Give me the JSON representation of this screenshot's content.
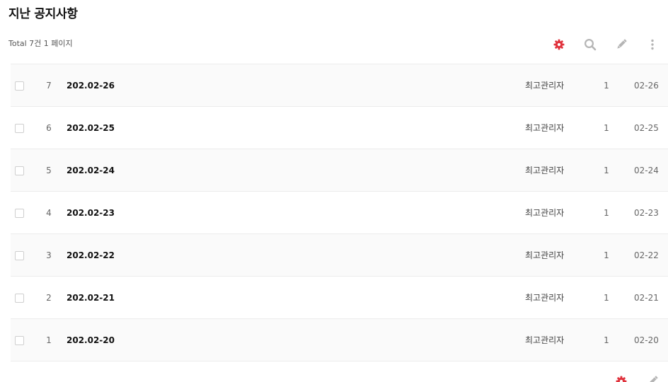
{
  "board": {
    "title": "지난 공지사항",
    "total_text": "Total 7건 1 페이지"
  },
  "colors": {
    "accent": "#e0323c",
    "icon_gray": "#b5b5b5",
    "row_alt": "#fafafa"
  },
  "toolbar": {
    "icons": [
      "gear-icon",
      "search-icon",
      "pencil-icon",
      "more-vertical-icon"
    ]
  },
  "posts": [
    {
      "num": "7",
      "subject": "202.02-26",
      "author": "최고관리자",
      "hits": "1",
      "date": "02-26"
    },
    {
      "num": "6",
      "subject": "202.02-25",
      "author": "최고관리자",
      "hits": "1",
      "date": "02-25"
    },
    {
      "num": "5",
      "subject": "202.02-24",
      "author": "최고관리자",
      "hits": "1",
      "date": "02-24"
    },
    {
      "num": "4",
      "subject": "202.02-23",
      "author": "최고관리자",
      "hits": "1",
      "date": "02-23"
    },
    {
      "num": "3",
      "subject": "202.02-22",
      "author": "최고관리자",
      "hits": "1",
      "date": "02-22"
    },
    {
      "num": "2",
      "subject": "202.02-21",
      "author": "최고관리자",
      "hits": "1",
      "date": "02-21"
    },
    {
      "num": "1",
      "subject": "202.02-20",
      "author": "최고관리자",
      "hits": "1",
      "date": "02-20"
    }
  ],
  "bottom_toolbar": {
    "icons": [
      "gear-icon",
      "pencil-icon"
    ]
  }
}
